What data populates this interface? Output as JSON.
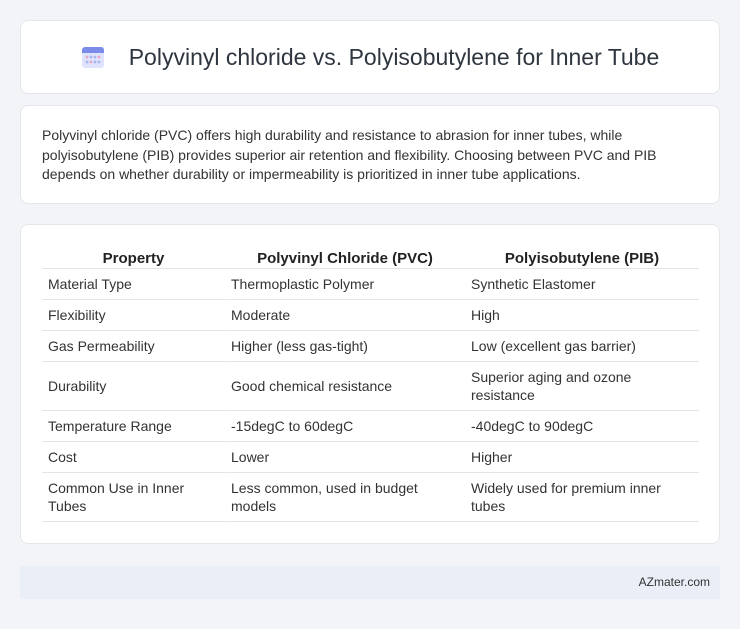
{
  "header": {
    "title": "Polyvinyl chloride vs. Polyisobutylene for Inner Tube",
    "icon": "calendar-icon"
  },
  "description": "Polyvinyl chloride (PVC) offers high durability and resistance to abrasion for inner tubes, while polyisobutylene (PIB) provides superior air retention and flexibility. Choosing between PVC and PIB depends on whether durability or impermeability is prioritized in inner tube applications.",
  "table": {
    "headers": [
      "Property",
      "Polyvinyl Chloride (PVC)",
      "Polyisobutylene (PIB)"
    ],
    "rows": [
      [
        "Material Type",
        "Thermoplastic Polymer",
        "Synthetic Elastomer"
      ],
      [
        "Flexibility",
        "Moderate",
        "High"
      ],
      [
        "Gas Permeability",
        "Higher (less gas-tight)",
        "Low (excellent gas barrier)"
      ],
      [
        "Durability",
        "Good chemical resistance",
        "Superior aging and ozone resistance"
      ],
      [
        "Temperature Range",
        "-15degC to 60degC",
        "-40degC to 90degC"
      ],
      [
        "Cost",
        "Lower",
        "Higher"
      ],
      [
        "Common Use in Inner Tubes",
        "Less common, used in budget models",
        "Widely used for premium inner tubes"
      ]
    ]
  },
  "footer": {
    "brand": "AZmater.com"
  }
}
